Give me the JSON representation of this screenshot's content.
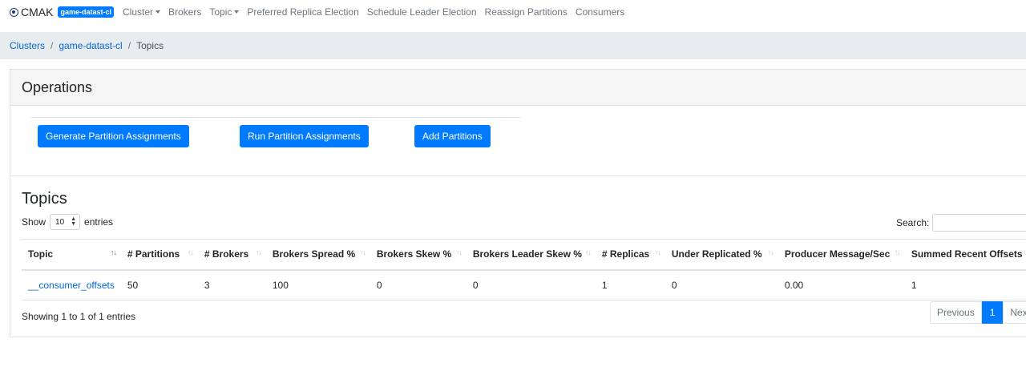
{
  "navbar": {
    "brand": "CMAK",
    "cluster_badge": "game-datast-cl",
    "items": [
      "Cluster",
      "Brokers",
      "Topic",
      "Preferred Replica Election",
      "Schedule Leader Election",
      "Reassign Partitions",
      "Consumers"
    ]
  },
  "breadcrumb": {
    "items": [
      "Clusters",
      "game-datast-cl",
      "Topics"
    ]
  },
  "operations": {
    "title": "Operations",
    "buttons": [
      "Generate Partition Assignments",
      "Run Partition Assignments",
      "Add Partitions"
    ]
  },
  "topics": {
    "title": "Topics",
    "show_label": "Show",
    "entries_value": "10",
    "entries_label": "entries",
    "search_label": "Search:",
    "columns": [
      "Topic",
      "# Partitions",
      "# Brokers",
      "Brokers Spread %",
      "Brokers Skew %",
      "Brokers Leader Skew %",
      "# Replicas",
      "Under Replicated %",
      "Producer Message/Sec",
      "Summed Recent Offsets"
    ],
    "rows": [
      [
        "__consumer_offsets",
        "50",
        "3",
        "100",
        "0",
        "0",
        "1",
        "0",
        "0.00",
        "1"
      ]
    ],
    "info": "Showing 1 to 1 of 1 entries",
    "pagination": {
      "previous": "Previous",
      "current": "1",
      "next": "Next"
    }
  },
  "colors": {
    "primary": "#007bff",
    "breadcrumb_bg": "#e9ecef"
  }
}
